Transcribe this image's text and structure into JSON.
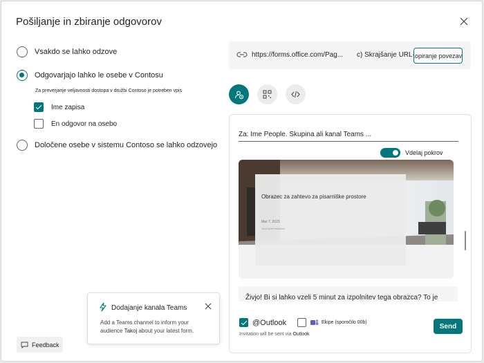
{
  "dialog": {
    "title": "Pošiljanje in zbiranje odgovorov",
    "close_icon": "close-icon"
  },
  "options": {
    "anyone": "Vsakdo se lahko odzove",
    "org": "Odgovarjajo lahko le osebe v Contosu",
    "org_note": "Za preverjanje veljavnosti dostopa v družbi Contoso je potreben vpis",
    "record_name": "Ime zapisa",
    "one_response": "En odgovor na osebo",
    "specific": "Določene osebe v sistemu Contoso se lahko odzovejo",
    "selected": "org",
    "record_name_checked": true,
    "one_response_checked": false
  },
  "link": {
    "url": "https://forms.office.com/Pag...",
    "shorten": "c) Skrajšanje URL-ja",
    "copy": "Kopiranje povezave"
  },
  "share_tabs": [
    "send-link-icon",
    "qr-code-icon",
    "embed-code-icon"
  ],
  "invite": {
    "to_placeholder": "Za: Ime People. Skupina ali kanal Teams ...",
    "highlight_toggle": "Vdelaj pokrov",
    "highlight_on": true,
    "form_title": "Obrazec za zahtevo za pisarniške prostore",
    "form_date": "Mar 7, 2023",
    "form_sub": "Your form invitation",
    "message": "Živjo! Bi si lahko vzeli 5 minut za izpolnitev tega obrazca? To je",
    "outlook_label": "@Outlook",
    "outlook_checked": true,
    "teams_label": "Ekipe (sporočilo 00b)",
    "teams_checked": false,
    "via_text": "Invitation will be sent via",
    "via_app": "Outlook",
    "send": "Send"
  },
  "teams_card": {
    "title": "Dodajanje kanala Teams",
    "desc_1": "Add a Teams channel to inform your",
    "desc_2": "audience",
    "desc_word": "Takoj",
    "desc_3": "about your latest form."
  },
  "feedback": "Feedback",
  "colors": {
    "accent": "#03787c",
    "panel_bg": "#f5f5f5"
  }
}
